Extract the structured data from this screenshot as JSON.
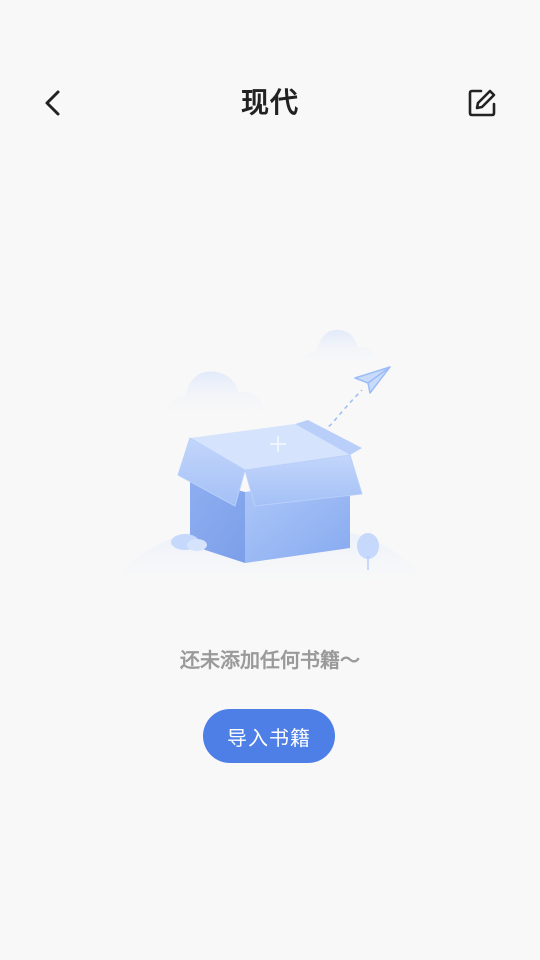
{
  "header": {
    "title": "现代",
    "back_icon": "chevron-left-icon",
    "edit_icon": "edit-icon"
  },
  "empty_state": {
    "illustration": "empty-box-illustration",
    "message": "还未添加任何书籍～",
    "import_button_label": "导入书籍"
  },
  "colors": {
    "background": "#f8f8f8",
    "title": "#222222",
    "message": "#9a9a9a",
    "button": "#4d7fe7",
    "button_text": "#ffffff",
    "illustration_blue": "#9bbcf7"
  }
}
